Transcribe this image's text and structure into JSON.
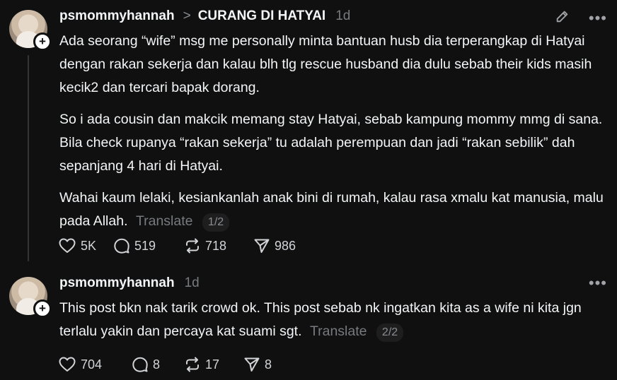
{
  "post1": {
    "username": "psmommyhannah",
    "chevron": ">",
    "topic": "CURANG DI HATYAI",
    "time": "1d",
    "paragraphs": [
      "Ada seorang “wife” msg me personally minta bantuan husb dia terperangkap di Hatyai dengan rakan sekerja dan kalau blh tlg rescue husband dia dulu sebab their kids masih kecik2 dan tercari bapak dorang.",
      "So i ada cousin dan makcik memang stay Hatyai, sebab kampung mommy mmg di sana. Bila check rupanya “rakan sekerja” tu adalah perempuan dan jadi “rakan sebilik” dah sepanjang 4 hari di Hatyai.",
      "Wahai kaum lelaki, kesiankanlah anak bini di rumah, kalau rasa xmalu kat manusia, malu pada Allah."
    ],
    "translate": "Translate",
    "page": "1/2",
    "likes": "5K",
    "replies": "519",
    "reposts": "718",
    "shares": "986"
  },
  "post2": {
    "username": "psmommyhannah",
    "time": "1d",
    "text": "This post bkn nak tarik crowd ok. This post sebab nk ingatkan kita as a wife ni kita jgn terlalu yakin dan percaya kat suami sgt.",
    "translate": "Translate",
    "page": "2/2",
    "likes": "704",
    "replies": "8",
    "reposts": "17",
    "shares": "8"
  },
  "icons": {
    "edit": "pencil-icon",
    "more": "more-dots-icon",
    "like": "heart-icon",
    "reply": "comment-icon",
    "repost": "repost-icon",
    "share": "send-icon"
  },
  "colors": {
    "background": "#101010",
    "text": "#f3f5f7",
    "muted": "#777a7e"
  }
}
